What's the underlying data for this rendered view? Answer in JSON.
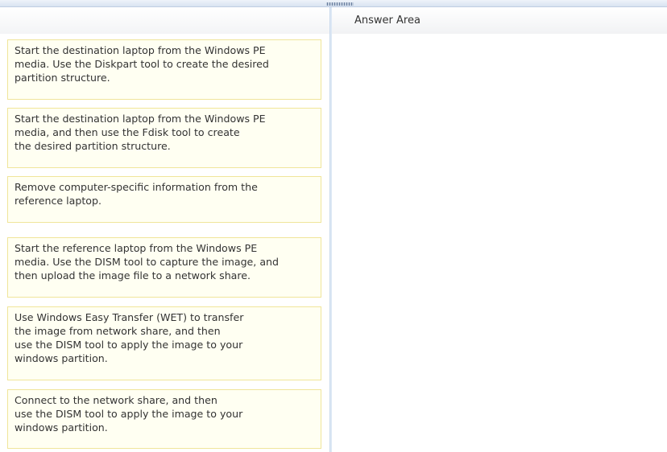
{
  "answer_area": {
    "title": "Answer Area"
  },
  "items": [
    {
      "lines": [
        "Start the destination laptop from the Windows PE",
        "media. Use the Diskpart tool to create the desired",
        "partition structure."
      ]
    },
    {
      "lines": [
        "Start the destination laptop from the Windows PE",
        "media, and then use the Fdisk tool to create",
        "the desired partition structure."
      ]
    },
    {
      "lines": [
        "Remove computer-specific information from the",
        "reference laptop."
      ]
    },
    {
      "lines": [
        "Start the reference laptop from the Windows PE",
        "media. Use the DISM tool to capture the image, and",
        "then upload the image file to a network share."
      ]
    },
    {
      "lines": [
        "Use Windows Easy Transfer (WET) to transfer",
        "the image from network share, and then",
        "use the DISM tool to apply the image to your",
        "windows partition."
      ]
    },
    {
      "lines": [
        "Connect to the network share, and then",
        "use the DISM tool to apply the image to your",
        "windows partition."
      ]
    }
  ]
}
